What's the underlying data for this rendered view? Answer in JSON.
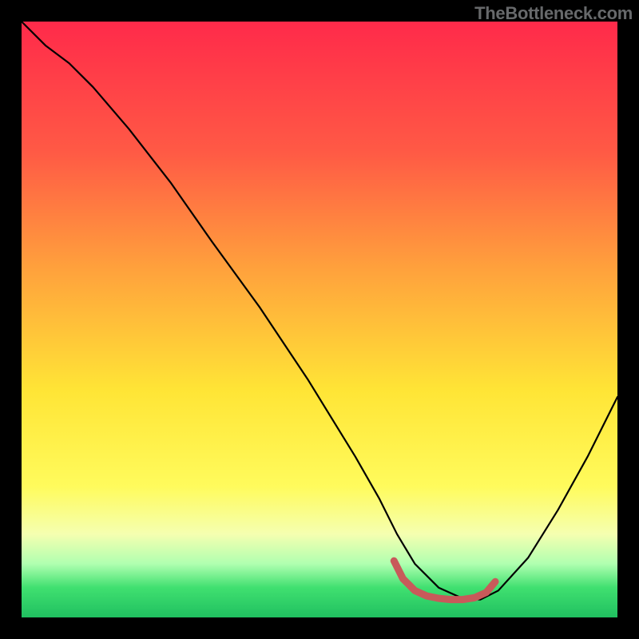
{
  "watermark": "TheBottleneck.com",
  "chart_data": {
    "type": "line",
    "title": "",
    "xlabel": "",
    "ylabel": "",
    "xlim": [
      0,
      100
    ],
    "ylim": [
      0,
      100
    ],
    "series": [
      {
        "name": "main-curve",
        "color": "#000000",
        "x": [
          0,
          4,
          8,
          12,
          18,
          25,
          32,
          40,
          48,
          56,
          60,
          63,
          66,
          70,
          74,
          77,
          80,
          85,
          90,
          95,
          100
        ],
        "y": [
          100,
          96,
          93,
          89,
          82,
          73,
          63,
          52,
          40,
          27,
          20,
          14,
          9,
          5,
          3.2,
          3.0,
          4.5,
          10,
          18,
          27,
          37
        ]
      },
      {
        "name": "trough-marker",
        "color": "#c85a5a",
        "x": [
          62.5,
          64,
          66,
          68,
          70,
          72,
          74,
          76,
          78,
          79.5
        ],
        "y": [
          9.5,
          6.5,
          4.5,
          3.6,
          3.2,
          3.0,
          3.0,
          3.3,
          4.2,
          6.0
        ]
      }
    ]
  }
}
